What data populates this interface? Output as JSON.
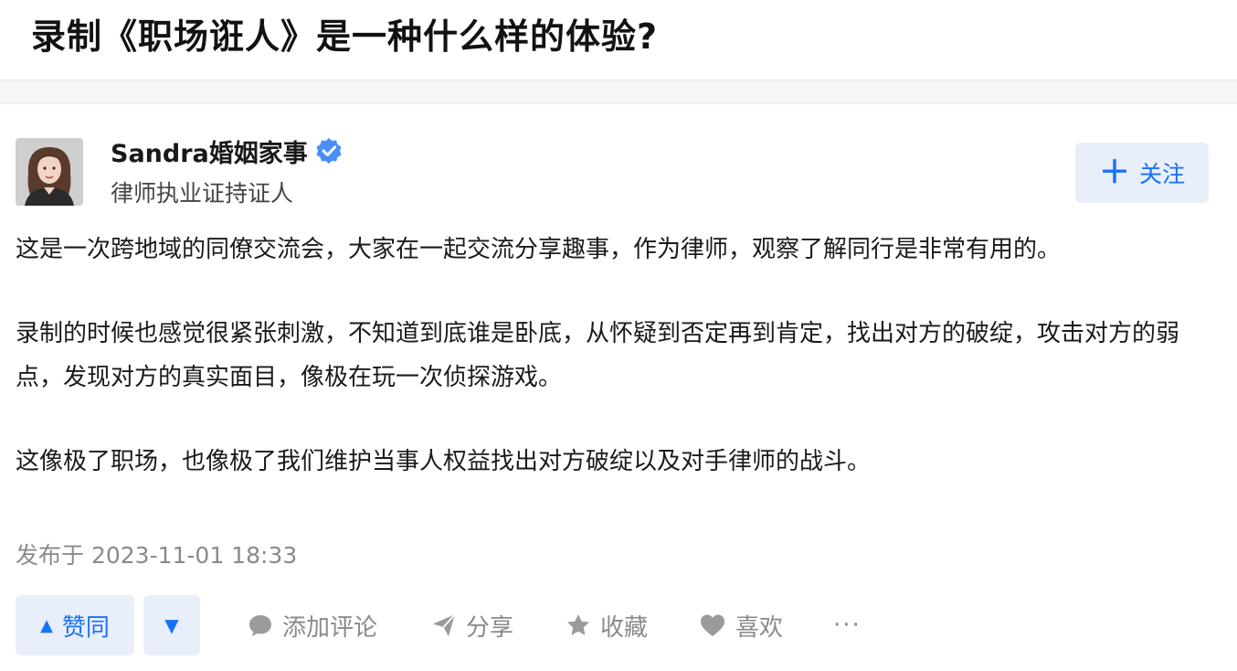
{
  "question": {
    "title": "录制《职场诳人》是一种什么样的体验?"
  },
  "author": {
    "name": "Sandra婚姻家事",
    "headline": "律师执业证持证人",
    "follow_label": "关注"
  },
  "answer": {
    "paragraphs": [
      "这是一次跨地域的同僚交流会，大家在一起交流分享趣事，作为律师，观察了解同行是非常有用的。",
      "录制的时候也感觉很紧张刺激，不知道到底谁是卧底，从怀疑到否定再到肯定，找出对方的破绽，攻击对方的弱点，发现对方的真实面目，像极在玩一次侦探游戏。",
      "这像极了职场，也像极了我们维护当事人权益找出对方破绽以及对手律师的战斗。"
    ],
    "publish_time": "发布于 2023-11-01 18:33"
  },
  "actions": {
    "vote_up_label": "赞同",
    "comment_label": "添加评论",
    "share_label": "分享",
    "collect_label": "收藏",
    "like_label": "喜欢",
    "more_label": "···"
  },
  "colors": {
    "accent": "#1772f6",
    "accent_bg": "#e8eefa",
    "muted": "#8a8a8a"
  },
  "icons": {
    "verified": "verified-badge-icon",
    "plus": "plus-icon",
    "vote_up": "triangle-up-icon",
    "vote_down": "triangle-down-icon",
    "comment": "comment-bubble-icon",
    "share": "paper-plane-icon",
    "collect": "star-icon",
    "like": "heart-icon",
    "more": "more-dots-icon"
  }
}
